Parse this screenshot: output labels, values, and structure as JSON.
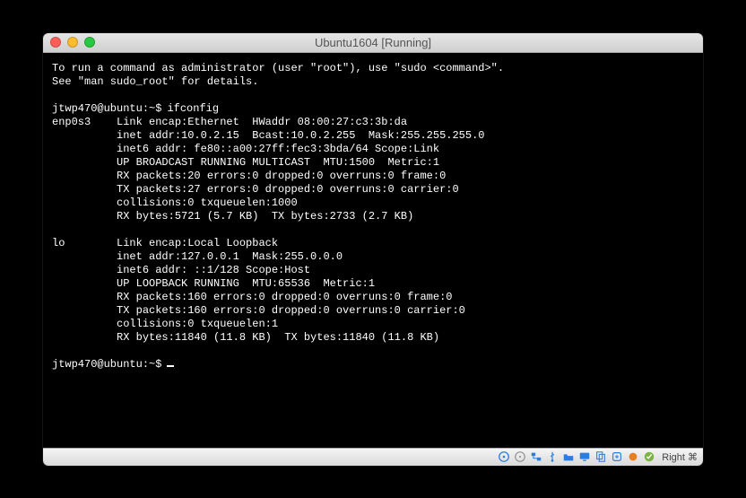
{
  "window": {
    "title": "Ubuntu1604 [Running]"
  },
  "terminal": {
    "intro": "To run a command as administrator (user \"root\"), use \"sudo <command>\".\nSee \"man sudo_root\" for details.\n\n",
    "prompt1": {
      "userhost": "jtwp470@ubuntu",
      "path": ":~",
      "symbol": "$",
      "command": "ifconfig"
    },
    "output": "enp0s3    Link encap:Ethernet  HWaddr 08:00:27:c3:3b:da\n          inet addr:10.0.2.15  Bcast:10.0.2.255  Mask:255.255.255.0\n          inet6 addr: fe80::a00:27ff:fec3:3bda/64 Scope:Link\n          UP BROADCAST RUNNING MULTICAST  MTU:1500  Metric:1\n          RX packets:20 errors:0 dropped:0 overruns:0 frame:0\n          TX packets:27 errors:0 dropped:0 overruns:0 carrier:0\n          collisions:0 txqueuelen:1000\n          RX bytes:5721 (5.7 KB)  TX bytes:2733 (2.7 KB)\n\nlo        Link encap:Local Loopback\n          inet addr:127.0.0.1  Mask:255.0.0.0\n          inet6 addr: ::1/128 Scope:Host\n          UP LOOPBACK RUNNING  MTU:65536  Metric:1\n          RX packets:160 errors:0 dropped:0 overruns:0 frame:0\n          TX packets:160 errors:0 dropped:0 overruns:0 carrier:0\n          collisions:0 txqueuelen:1\n          RX bytes:11840 (11.8 KB)  TX bytes:11840 (11.8 KB)\n",
    "prompt2": {
      "userhost": "jtwp470@ubuntu",
      "path": ":~",
      "symbol": "$",
      "command": ""
    }
  },
  "statusbar": {
    "right_text": "Right ⌘"
  }
}
